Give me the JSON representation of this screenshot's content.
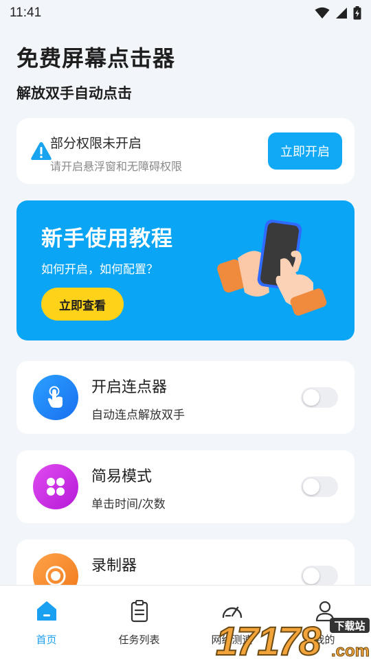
{
  "status_bar": {
    "time": "11:41",
    "icons": [
      "wifi-icon",
      "signal-icon",
      "battery-charging-icon"
    ]
  },
  "header": {
    "title": "免费屏幕点击器",
    "subtitle": "解放双手自动点击"
  },
  "permission_card": {
    "icon": "warning-icon",
    "title": "部分权限未开启",
    "description": "请开启悬浮窗和无障碍权限",
    "button_label": "立即开启"
  },
  "tutorial_banner": {
    "title": "新手使用教程",
    "subtitle": "如何开启，如何配置？",
    "button_label": "立即查看",
    "illustration": "hand-holding-phone-icon"
  },
  "features": [
    {
      "icon": "tap-hand-icon",
      "title": "开启连点器",
      "description": "自动连点解放双手",
      "enabled": false
    },
    {
      "icon": "four-petal-icon",
      "title": "简易模式",
      "description": "单击时间/次数",
      "enabled": false
    },
    {
      "icon": "record-icon",
      "title": "录制器",
      "description": "",
      "enabled": false
    }
  ],
  "bottom_nav": {
    "items": [
      {
        "label": "首页",
        "icon": "home-icon",
        "active": true
      },
      {
        "label": "任务列表",
        "icon": "clipboard-icon",
        "active": false
      },
      {
        "label": "网络测速",
        "icon": "speedometer-icon",
        "active": false
      },
      {
        "label": "我的",
        "icon": "user-icon",
        "active": false
      }
    ]
  },
  "watermark": {
    "number": "17178",
    "suffix": ".com",
    "badge": "下载站"
  },
  "colors": {
    "accent": "#11a9f5",
    "banner": "#0aa6f5",
    "banner_button": "#ffd21a",
    "nav_active": "#1aa0f0",
    "background": "#f2f6fa"
  }
}
